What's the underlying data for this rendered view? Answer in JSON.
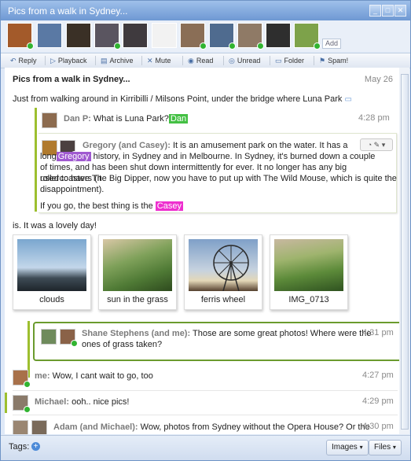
{
  "window": {
    "title": "Pics from a walk in Sydney...",
    "controls": [
      "_",
      "□",
      "✕"
    ]
  },
  "participants": {
    "add_label": "Add",
    "avatars": [
      {
        "name": "avatar-1",
        "color": "#a35a2a",
        "online": true
      },
      {
        "name": "avatar-2",
        "color": "#5a79a4",
        "online": false
      },
      {
        "name": "avatar-3",
        "color": "#3a3026",
        "online": false
      },
      {
        "name": "avatar-4",
        "color": "#5a5560",
        "online": true
      },
      {
        "name": "avatar-5",
        "color": "#3f3a3e",
        "online": false
      },
      {
        "name": "avatar-6",
        "color": "#f2f2f2",
        "online": false
      },
      {
        "name": "avatar-7",
        "color": "#8a6e56",
        "online": true
      },
      {
        "name": "avatar-8",
        "color": "#4f6b8f",
        "online": true
      },
      {
        "name": "avatar-9",
        "color": "#8f7a66",
        "online": true
      },
      {
        "name": "avatar-10",
        "color": "#2e2e2e",
        "online": false
      },
      {
        "name": "avatar-11",
        "color": "#7da24a",
        "online": true
      }
    ]
  },
  "toolbar": {
    "items": [
      {
        "label": "Reply",
        "icon": "reply-icon",
        "glyph": "↶"
      },
      {
        "label": "Playback",
        "icon": "playback-icon",
        "glyph": "▷"
      },
      {
        "label": "Archive",
        "icon": "archive-icon",
        "glyph": "▤"
      },
      {
        "label": "Mute",
        "icon": "mute-icon",
        "glyph": "✕"
      },
      {
        "label": "Read",
        "icon": "read-icon",
        "glyph": "◉"
      },
      {
        "label": "Unread",
        "icon": "unread-icon",
        "glyph": "◎"
      },
      {
        "label": "Folder",
        "icon": "folder-icon",
        "glyph": "▭"
      },
      {
        "label": "Spam!",
        "icon": "spam-icon",
        "glyph": "⚑"
      }
    ]
  },
  "wave": {
    "subject": "Pics from a walk in Sydney...",
    "date": "May 26",
    "intro": "Just from walking around in Kirribilli / Milsons Point, under the bridge where Luna Park",
    "intro_tail": "is. It was a lovely day!",
    "reply1": {
      "author": "Dan P:",
      "text": "What is Luna Park?",
      "tag": "Dan",
      "time": "4:28 pm"
    },
    "reply2": {
      "author": "Gregory (and Casey):",
      "line1": "It is an amusement park on the water. It has a",
      "line2_pre": "long",
      "tag1": "Gregory",
      "line2_post": "history, in Sydney and in Melbourne. In Sydney, it's burned down a couple",
      "line3": "of times, and has been shut down intermittently for ever. It no longer has any big rollercoasters (it",
      "line4": "used to have The Big Dipper, now you have to put up with The Wild Mouse, which is quite the",
      "line5": "disappointment).",
      "line6_pre": "If you go, the best thing is the",
      "tag2": "Casey"
    },
    "photos": [
      {
        "caption": "clouds"
      },
      {
        "caption": "sun in the grass"
      },
      {
        "caption": "ferris wheel"
      },
      {
        "caption": "IMG_0713"
      }
    ],
    "reply3": {
      "author": "Shane Stephens (and me):",
      "text1": "Those are some great photos!  Where were the",
      "text2": "ones of grass taken?",
      "time": "4:31 pm"
    },
    "reply4": {
      "author": "me:",
      "text": "Wow, I cant wait to go, too",
      "time": "4:27 pm"
    },
    "reply5": {
      "author": "Michael:",
      "text": "ooh.. nice pics!",
      "time": "4:29 pm"
    },
    "reply6": {
      "author": "Adam (and Michael):",
      "text": "Wow, photos from Sydney without the Opera House?  Or the",
      "time": "4:30 pm"
    }
  },
  "footer": {
    "tags_label": "Tags:",
    "images_label": "Images",
    "files_label": "Files"
  }
}
